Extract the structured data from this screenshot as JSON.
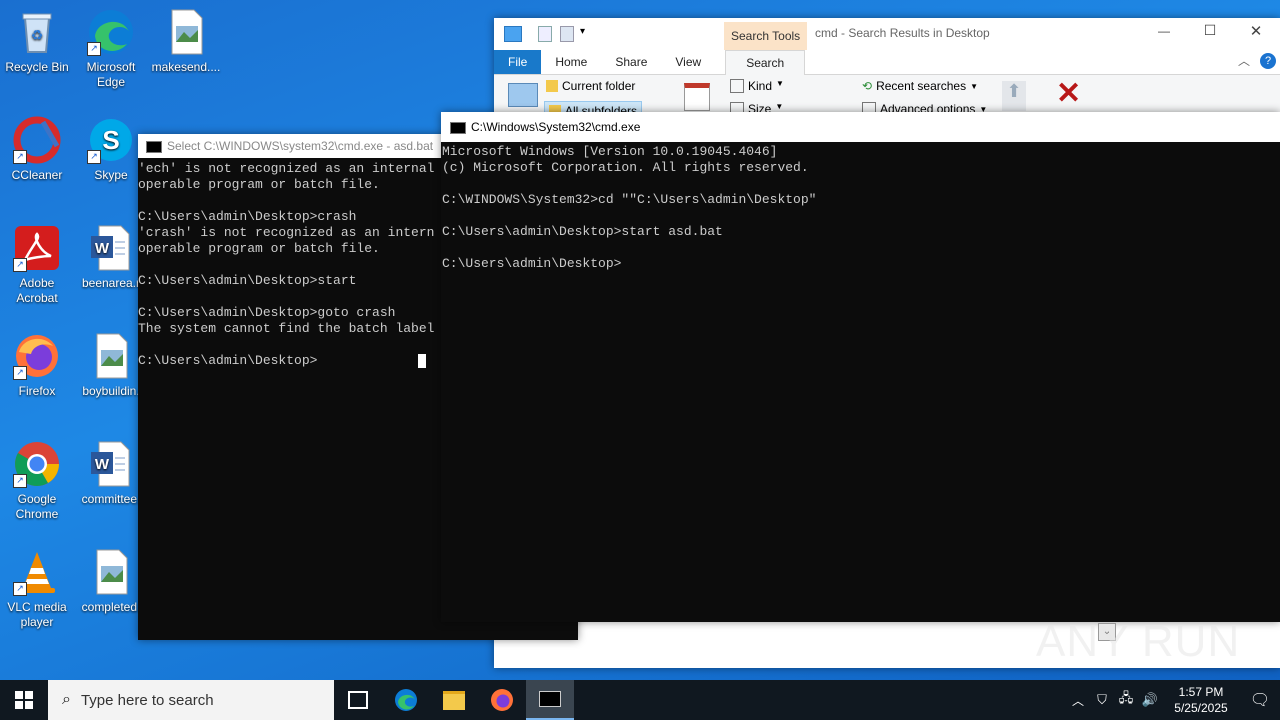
{
  "desktop": {
    "icons": [
      {
        "label": "Recycle Bin"
      },
      {
        "label": "Microsoft Edge"
      },
      {
        "label": "makesend...."
      },
      {
        "label": "CCleaner"
      },
      {
        "label": "Skype"
      },
      {
        "label": "Adobe Acrobat"
      },
      {
        "label": "beenarea.r"
      },
      {
        "label": "Firefox"
      },
      {
        "label": "boybuildin."
      },
      {
        "label": "Google Chrome"
      },
      {
        "label": "committee."
      },
      {
        "label": "VLC media player"
      },
      {
        "label": "completed."
      }
    ]
  },
  "explorer": {
    "title": "cmd - Search Results in Desktop",
    "context_tab": "Search Tools",
    "tabs": [
      "File",
      "Home",
      "Share",
      "View",
      "Search"
    ],
    "ribbon": {
      "current_folder": "Current folder",
      "all_subfolders": "All subfolders",
      "kind": "Kind",
      "size": "Size",
      "recent_searches": "Recent searches",
      "advanced_options": "Advanced options"
    }
  },
  "cmd_back": {
    "title": "Select C:\\WINDOWS\\system32\\cmd.exe - asd.bat",
    "lines": [
      "'ech' is not recognized as an internal",
      "operable program or batch file.",
      "",
      "C:\\Users\\admin\\Desktop>crash",
      "'crash' is not recognized as an intern",
      "operable program or batch file.",
      "",
      "C:\\Users\\admin\\Desktop>start",
      "",
      "C:\\Users\\admin\\Desktop>goto crash",
      "The system cannot find the batch label",
      "",
      "C:\\Users\\admin\\Desktop>"
    ]
  },
  "cmd_front": {
    "title": "C:\\Windows\\System32\\cmd.exe",
    "lines": [
      "Microsoft Windows [Version 10.0.19045.4046]",
      "(c) Microsoft Corporation. All rights reserved.",
      "",
      "C:\\WINDOWS\\System32>cd \"\"C:\\Users\\admin\\Desktop\"",
      "",
      "C:\\Users\\admin\\Desktop>start asd.bat",
      "",
      "C:\\Users\\admin\\Desktop>"
    ]
  },
  "watermark": "ANY RUN",
  "taskbar": {
    "search_placeholder": "Type here to search",
    "time": "1:57 PM",
    "date": "5/25/2025"
  },
  "colors": {
    "accent": "#0078d7",
    "taskbar": "#101820",
    "console_bg": "#0c0c0c",
    "close_red": "#c42b1c"
  }
}
